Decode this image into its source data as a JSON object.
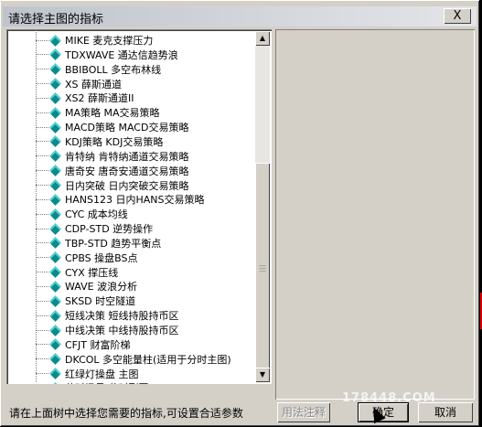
{
  "dialog": {
    "title": "请选择主图的指标",
    "close_label": "X"
  },
  "tree": {
    "items": [
      {
        "label": "MIKE 麦克支撑压力"
      },
      {
        "label": "TDXWAVE 通达信趋势浪"
      },
      {
        "label": "BBIBOLL 多空布林线"
      },
      {
        "label": "XS 薛斯通道"
      },
      {
        "label": "XS2 薛斯通道II"
      },
      {
        "label": "MA策略 MA交易策略"
      },
      {
        "label": "MACD策略 MACD交易策略"
      },
      {
        "label": "KDJ策略 KDJ交易策略"
      },
      {
        "label": "肯特纳 肯特纳通道交易策略"
      },
      {
        "label": "唐奇安 唐奇安通道交易策略"
      },
      {
        "label": "日内突破 日内突破交易策略"
      },
      {
        "label": "HANS123 日内HANS交易策略"
      },
      {
        "label": "CYC 成本均线"
      },
      {
        "label": "CDP-STD 逆势操作"
      },
      {
        "label": "TBP-STD 趋势平衡点"
      },
      {
        "label": "CPBS 操盘BS点"
      },
      {
        "label": "CYX 撑压线"
      },
      {
        "label": "WAVE 波浪分析"
      },
      {
        "label": "SKSD 时空隧道"
      },
      {
        "label": "短线决策 短线持股持币区"
      },
      {
        "label": "中线决策 中线持股持币区"
      },
      {
        "label": "CFJT 财富阶梯"
      },
      {
        "label": "DKCOL 多空能量柱(适用于分时主图)"
      },
      {
        "label": "红绿灯操盘 主图"
      },
      {
        "label": "分时讯号 分时副图"
      }
    ]
  },
  "footer": {
    "status": "请在上面树中选择您需要的指标,可设置合适参数",
    "usage_button": "用法注释",
    "ok_button": "确定",
    "cancel_button": "取消",
    "watermark": "178448.COM"
  },
  "icons": {
    "tree_item_icon": "indicator-gem-icon",
    "scroll_up": "arrow-up-icon",
    "scroll_down": "arrow-down-icon"
  },
  "colors": {
    "dialog_bg": "#d4d0c8",
    "gem": "#0a8a8a"
  }
}
